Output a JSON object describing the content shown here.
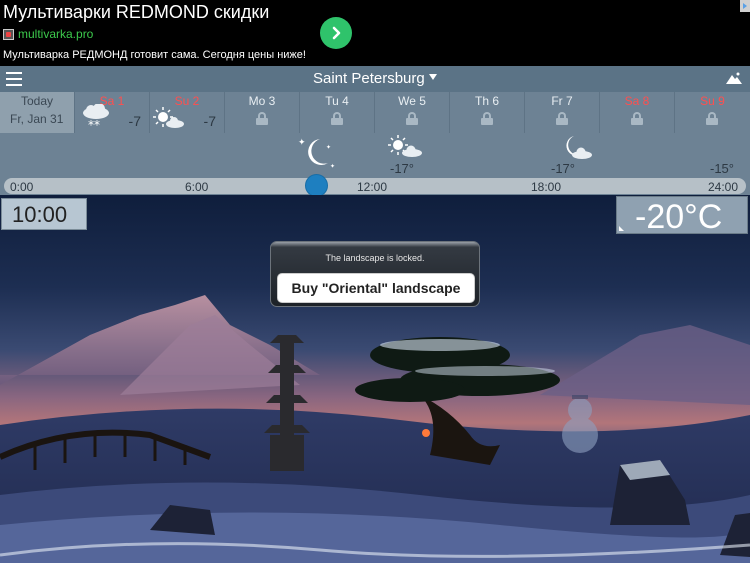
{
  "ad": {
    "title": "Мультиварки REDMOND скидки",
    "url": "multivarka.pro",
    "description": "Мультиварка РЕДМОНД готовит сама. Сегодня цены ниже!",
    "go_icon": "chevron-right-icon",
    "adchoices_icon": "adchoices-icon",
    "colors": {
      "go_button": "#2fc36b",
      "url": "#3cc94c"
    }
  },
  "topbar": {
    "city": "Saint Petersburg",
    "menu_icon": "hamburger-menu-icon",
    "landscape_icon": "mountain-icon"
  },
  "days": [
    {
      "name": "Today",
      "date": "Fr, Jan 31",
      "today": true
    },
    {
      "name": "Sa 1",
      "temp": "-7",
      "weekend": true,
      "icon": "cloud-snow-icon"
    },
    {
      "name": "Su 2",
      "temp": "-7",
      "weekend": true,
      "icon": "sun-cloud-icon"
    },
    {
      "name": "Mo 3",
      "locked": true
    },
    {
      "name": "Tu 4",
      "locked": true
    },
    {
      "name": "We 5",
      "locked": true
    },
    {
      "name": "Th 6",
      "locked": true
    },
    {
      "name": "Fr 7",
      "locked": true
    },
    {
      "name": "Sa 8",
      "locked": true,
      "weekend": true
    },
    {
      "name": "Su 9",
      "locked": true,
      "weekend": true
    }
  ],
  "hourly": [
    {
      "icon": "moon-stars-icon",
      "temp": ""
    },
    {
      "icon": "sun-cloud-icon",
      "temp": "-17°"
    },
    {
      "icon": "moon-cloud-icon",
      "temp": "-17°"
    },
    {
      "icon": "",
      "temp": "-15°"
    }
  ],
  "timeline": {
    "ticks": [
      "0:00",
      "6:00",
      "12:00",
      "18:00",
      "24:00"
    ],
    "position_hours": 10
  },
  "display": {
    "time": "10:00",
    "temperature": "-20°C"
  },
  "modal": {
    "message": "The landscape is locked.",
    "button": "Buy \"Oriental\" landscape"
  },
  "colors": {
    "weekend": "#ff4f4f",
    "knob": "#1e7fc0",
    "strip": "#6d8294"
  }
}
